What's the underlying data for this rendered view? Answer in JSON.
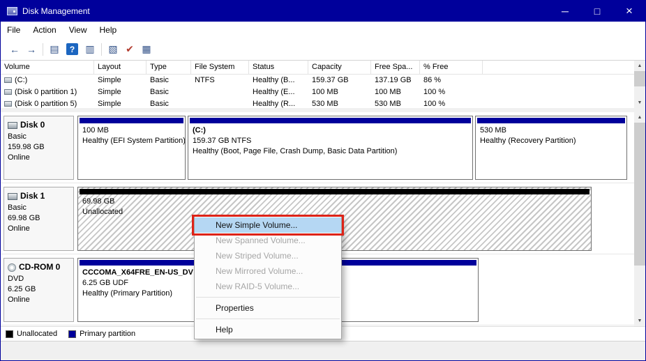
{
  "window": {
    "title": "Disk Management",
    "controls": {
      "minimize": "─",
      "maximize": "□",
      "close": "×"
    }
  },
  "menu_bar": {
    "items": [
      {
        "label": "File"
      },
      {
        "label": "Action"
      },
      {
        "label": "View"
      },
      {
        "label": "Help"
      }
    ]
  },
  "toolbar": {
    "icons": [
      {
        "name": "back-icon",
        "glyph": "←"
      },
      {
        "name": "forward-icon",
        "glyph": "→"
      },
      {
        "name": "console-tree-icon",
        "glyph": "▤"
      },
      {
        "name": "help-icon",
        "glyph": "?"
      },
      {
        "name": "action-pane-icon",
        "glyph": "▥"
      },
      {
        "name": "dialog-icon",
        "glyph": "▧"
      },
      {
        "name": "check-icon",
        "glyph": "✔"
      },
      {
        "name": "list-view-icon",
        "glyph": "▦"
      }
    ]
  },
  "volume_table": {
    "columns": [
      {
        "label": "Volume"
      },
      {
        "label": "Layout"
      },
      {
        "label": "Type"
      },
      {
        "label": "File System"
      },
      {
        "label": "Status"
      },
      {
        "label": "Capacity"
      },
      {
        "label": "Free Spa..."
      },
      {
        "label": "% Free"
      }
    ],
    "rows": [
      {
        "volume": "(C:)",
        "layout": "Simple",
        "type": "Basic",
        "file_system": "NTFS",
        "status": "Healthy (B...",
        "capacity": "159.37 GB",
        "free_space": "137.19 GB",
        "pct_free": "86 %"
      },
      {
        "volume": "(Disk 0 partition 1)",
        "layout": "Simple",
        "type": "Basic",
        "file_system": "",
        "status": "Healthy (E...",
        "capacity": "100 MB",
        "free_space": "100 MB",
        "pct_free": "100 %"
      },
      {
        "volume": "(Disk 0 partition 5)",
        "layout": "Simple",
        "type": "Basic",
        "file_system": "",
        "status": "Healthy (R...",
        "capacity": "530 MB",
        "free_space": "530 MB",
        "pct_free": "100 %"
      }
    ]
  },
  "graphic_view": {
    "disks": [
      {
        "name": "Disk 0",
        "kind": "Basic",
        "size": "159.98 GB",
        "status": "Online",
        "partitions": [
          {
            "lines": [
              "100 MB",
              "Healthy (EFI System Partition)"
            ]
          },
          {
            "lines": [
              "(C:)",
              "159.37 GB NTFS",
              "Healthy (Boot, Page File, Crash Dump, Basic Data Partition)"
            ]
          },
          {
            "lines": [
              "530 MB",
              "Healthy (Recovery Partition)"
            ]
          }
        ]
      },
      {
        "name": "Disk 1",
        "kind": "Basic",
        "size": "69.98 GB",
        "status": "Online",
        "partitions": [
          {
            "lines": [
              "69.98 GB",
              "Unallocated"
            ]
          }
        ]
      },
      {
        "name": "CD-ROM 0",
        "kind": "DVD",
        "size": "6.25 GB",
        "status": "Online",
        "partitions": [
          {
            "lines": [
              "CCCOMA_X64FRE_EN-US_DV",
              "6.25 GB UDF",
              "Healthy (Primary Partition)"
            ]
          }
        ]
      }
    ]
  },
  "context_menu": {
    "items": [
      {
        "label": "New Simple Volume...",
        "state": "highlighted"
      },
      {
        "label": "New Spanned Volume...",
        "state": "disabled"
      },
      {
        "label": "New Striped Volume...",
        "state": "disabled"
      },
      {
        "label": "New Mirrored Volume...",
        "state": "disabled"
      },
      {
        "label": "New RAID-5 Volume...",
        "state": "disabled"
      },
      {
        "label": "Properties",
        "state": "normal"
      },
      {
        "label": "Help",
        "state": "normal"
      }
    ]
  },
  "legend": {
    "items": [
      {
        "label": "Unallocated",
        "color": "#000000"
      },
      {
        "label": "Primary partition",
        "color": "#00009b"
      }
    ]
  },
  "colors": {
    "titlebar": "#00009b",
    "primary_partition": "#00009b",
    "unallocated": "#000000",
    "menu_highlight": "#b5d7f3",
    "annotation_red": "#dd2318"
  }
}
